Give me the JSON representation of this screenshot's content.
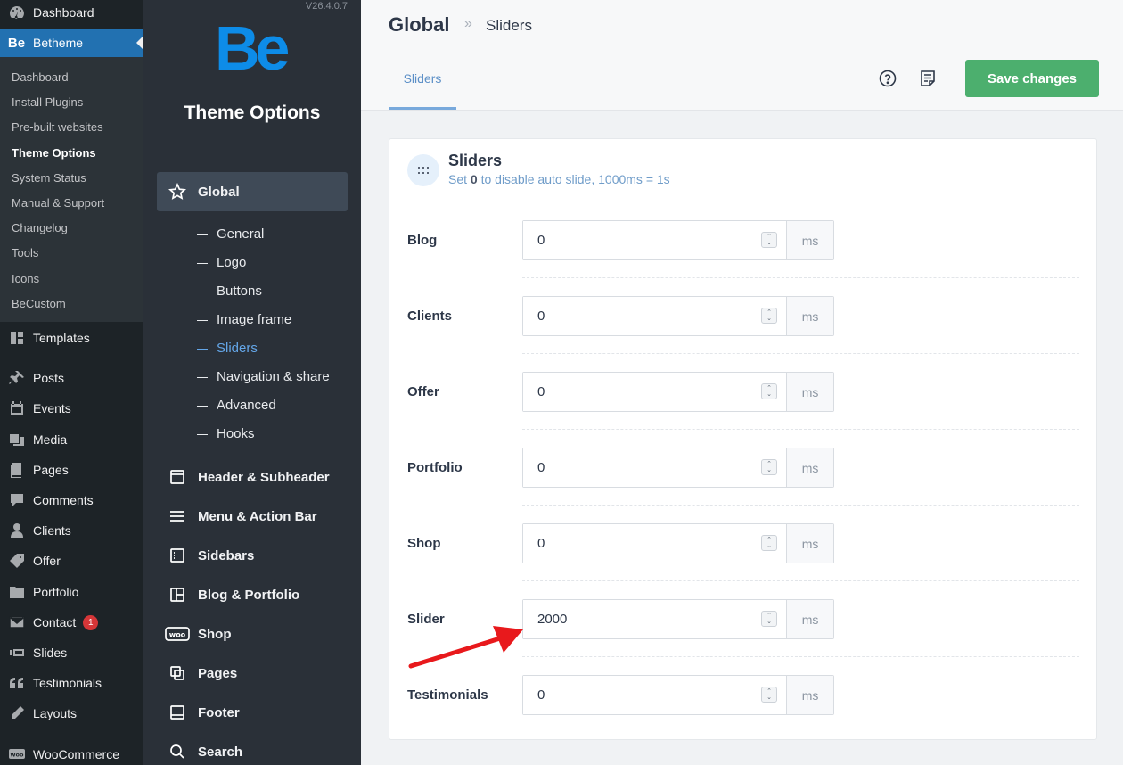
{
  "wp_menu": {
    "top": [
      {
        "label": "Dashboard",
        "icon": "dashboard-icon"
      },
      {
        "label": "Betheme",
        "icon": "betheme-logo-icon",
        "current": true
      }
    ],
    "betheme_sub": [
      {
        "label": "Dashboard"
      },
      {
        "label": "Install Plugins"
      },
      {
        "label": "Pre-built websites"
      },
      {
        "label": "Theme Options",
        "active": true
      },
      {
        "label": "System Status"
      },
      {
        "label": "Manual & Support"
      },
      {
        "label": "Changelog"
      },
      {
        "label": "Tools"
      },
      {
        "label": "Icons"
      },
      {
        "label": "BeCustom"
      }
    ],
    "items": [
      {
        "label": "Templates",
        "icon": "templates-icon"
      },
      {
        "label": "Posts",
        "icon": "pin-icon"
      },
      {
        "label": "Events",
        "icon": "calendar-icon"
      },
      {
        "label": "Media",
        "icon": "media-icon"
      },
      {
        "label": "Pages",
        "icon": "pages-icon"
      },
      {
        "label": "Comments",
        "icon": "comment-icon"
      },
      {
        "label": "Clients",
        "icon": "user-icon"
      },
      {
        "label": "Offer",
        "icon": "tag-icon"
      },
      {
        "label": "Portfolio",
        "icon": "folder-icon"
      },
      {
        "label": "Contact",
        "icon": "mail-icon",
        "badge": "1"
      },
      {
        "label": "Slides",
        "icon": "slides-icon"
      },
      {
        "label": "Testimonials",
        "icon": "quote-icon"
      },
      {
        "label": "Layouts",
        "icon": "pencil-icon"
      },
      {
        "label": "WooCommerce",
        "icon": "woo-icon"
      }
    ]
  },
  "theme_nav": {
    "version": "V26.4.0.7",
    "logo_text": "Be",
    "title": "Theme Options",
    "global_label": "Global",
    "global_sub": [
      {
        "label": "General"
      },
      {
        "label": "Logo"
      },
      {
        "label": "Buttons"
      },
      {
        "label": "Image frame"
      },
      {
        "label": "Sliders",
        "active": true
      },
      {
        "label": "Navigation & share"
      },
      {
        "label": "Advanced"
      },
      {
        "label": "Hooks"
      }
    ],
    "sections": [
      {
        "label": "Header & Subheader",
        "icon": "header-icon"
      },
      {
        "label": "Menu & Action Bar",
        "icon": "menu-icon"
      },
      {
        "label": "Sidebars",
        "icon": "sidebar-icon"
      },
      {
        "label": "Blog & Portfolio",
        "icon": "grid-icon"
      },
      {
        "label": "Shop",
        "icon": "woo-icon"
      },
      {
        "label": "Pages",
        "icon": "pages-icon"
      },
      {
        "label": "Footer",
        "icon": "footer-icon"
      },
      {
        "label": "Search",
        "icon": "search-icon"
      }
    ]
  },
  "header": {
    "crumb_root": "Global",
    "crumb_sep": "»",
    "crumb_current": "Sliders",
    "tab": "Sliders",
    "save_label": "Save changes"
  },
  "card": {
    "title": "Sliders",
    "desc_prefix": "Set ",
    "desc_bold": "0",
    "desc_suffix": " to disable auto slide, 1000ms = 1s",
    "unit": "ms",
    "rows": [
      {
        "label": "Blog",
        "value": "0"
      },
      {
        "label": "Clients",
        "value": "0"
      },
      {
        "label": "Offer",
        "value": "0"
      },
      {
        "label": "Portfolio",
        "value": "0"
      },
      {
        "label": "Shop",
        "value": "0"
      },
      {
        "label": "Slider",
        "value": "2000"
      },
      {
        "label": "Testimonials",
        "value": "0"
      }
    ]
  },
  "colors": {
    "wp_sidebar": "#1d2327",
    "wp_current": "#2271b1",
    "theme_nav": "#2a3038",
    "accent": "#64a6e8",
    "save": "#4caf6e",
    "arrow": "#e8191c"
  }
}
